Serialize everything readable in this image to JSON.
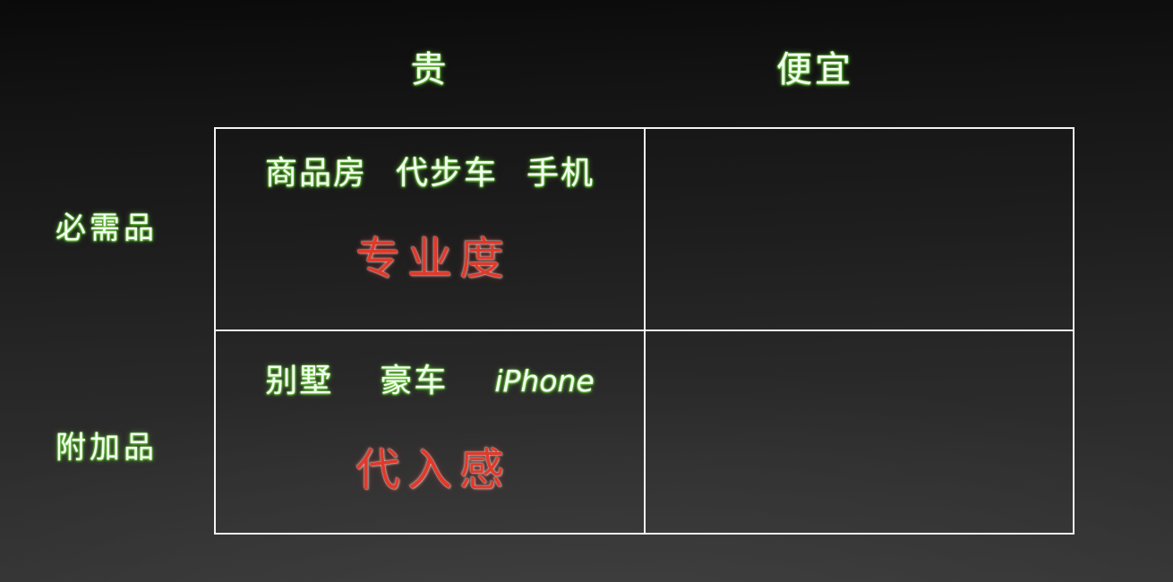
{
  "colors": {
    "chalk_green": "#f2fff0",
    "chalk_green_glow": "#7ddc4e",
    "chalk_red": "#e2392a",
    "grid_line": "#f3f3f3",
    "background_top": "#0a0a0a",
    "background_bottom": "#343434"
  },
  "matrix": {
    "column_headers": [
      {
        "id": "expensive",
        "label": "贵"
      },
      {
        "id": "cheap",
        "label": "便宜"
      }
    ],
    "row_headers": [
      {
        "id": "necessity",
        "label": "必需品"
      },
      {
        "id": "addon",
        "label": "附加品"
      }
    ],
    "cells": [
      {
        "id": "necessity-expensive",
        "row": "necessity",
        "column": "expensive",
        "items": [
          "商品房",
          "代步车",
          "手机"
        ],
        "emphasis": "专业度"
      },
      {
        "id": "necessity-cheap",
        "row": "necessity",
        "column": "cheap",
        "items": [],
        "emphasis": ""
      },
      {
        "id": "addon-expensive",
        "row": "addon",
        "column": "expensive",
        "items": [
          "别墅",
          "豪车",
          "iPhone"
        ],
        "emphasis": "代入感"
      },
      {
        "id": "addon-cheap",
        "row": "addon",
        "column": "cheap",
        "items": [],
        "emphasis": ""
      }
    ]
  }
}
